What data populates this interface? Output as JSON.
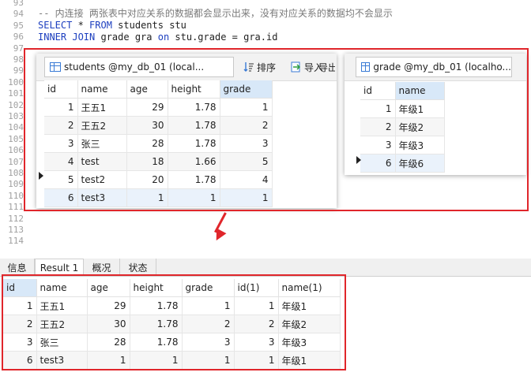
{
  "editor": {
    "lines": [
      {
        "num": "93",
        "text": ""
      },
      {
        "num": "94",
        "text": "-- 内连接 两张表中对应关系的数据都会显示出来，没有对应关系的数据均不会显示"
      },
      {
        "num": "95",
        "kw1": "SELECT",
        "mid1": " * ",
        "kw2": "FROM",
        "rest": " students stu"
      },
      {
        "num": "96",
        "kw1": "INNER JOIN",
        "mid1": " grade gra ",
        "kw2": "on",
        "rest": " stu.grade = gra.id"
      },
      {
        "num": "97"
      },
      {
        "num": "98"
      },
      {
        "num": "99"
      },
      {
        "num": "100"
      },
      {
        "num": "101"
      },
      {
        "num": "102"
      },
      {
        "num": "103"
      },
      {
        "num": "104"
      },
      {
        "num": "105"
      },
      {
        "num": "106"
      },
      {
        "num": "107"
      },
      {
        "num": "108"
      },
      {
        "num": "109"
      },
      {
        "num": "110"
      },
      {
        "num": "111"
      },
      {
        "num": "112"
      },
      {
        "num": "113"
      },
      {
        "num": "114"
      }
    ]
  },
  "students_panel": {
    "tab_title": "students @my_db_01 (local...",
    "toolbar": {
      "sort": "排序",
      "import": "导入",
      "export": "导出"
    },
    "columns": [
      "id",
      "name",
      "age",
      "height",
      "grade"
    ],
    "rows": [
      [
        "1",
        "王五1",
        "29",
        "1.78",
        "1"
      ],
      [
        "2",
        "王五2",
        "30",
        "1.78",
        "2"
      ],
      [
        "3",
        "张三",
        "28",
        "1.78",
        "3"
      ],
      [
        "4",
        "test",
        "18",
        "1.66",
        "5"
      ],
      [
        "5",
        "test2",
        "20",
        "1.78",
        "4"
      ],
      [
        "6",
        "test3",
        "1",
        "1",
        "1"
      ]
    ]
  },
  "grade_panel": {
    "tab_title": "grade @my_db_01 (localho...",
    "columns": [
      "id",
      "name"
    ],
    "rows": [
      [
        "1",
        "年级1"
      ],
      [
        "2",
        "年级2"
      ],
      [
        "3",
        "年级3"
      ],
      [
        "6",
        "年级6"
      ]
    ]
  },
  "result_tabs": [
    "信息",
    "Result 1",
    "概况",
    "状态"
  ],
  "result": {
    "columns": [
      "id",
      "name",
      "age",
      "height",
      "grade",
      "id(1)",
      "name(1)"
    ],
    "rows": [
      [
        "1",
        "王五1",
        "29",
        "1.78",
        "1",
        "1",
        "年级1"
      ],
      [
        "2",
        "王五2",
        "30",
        "1.78",
        "2",
        "2",
        "年级2"
      ],
      [
        "3",
        "张三",
        "28",
        "1.78",
        "3",
        "3",
        "年级3"
      ],
      [
        "6",
        "test3",
        "1",
        "1",
        "1",
        "1",
        "年级1"
      ]
    ]
  },
  "colors": {
    "annotation": "#e0262b",
    "keyword": "#1d3fbf",
    "comment": "#7a7a7a",
    "header_highlight": "#d8e8f8"
  }
}
